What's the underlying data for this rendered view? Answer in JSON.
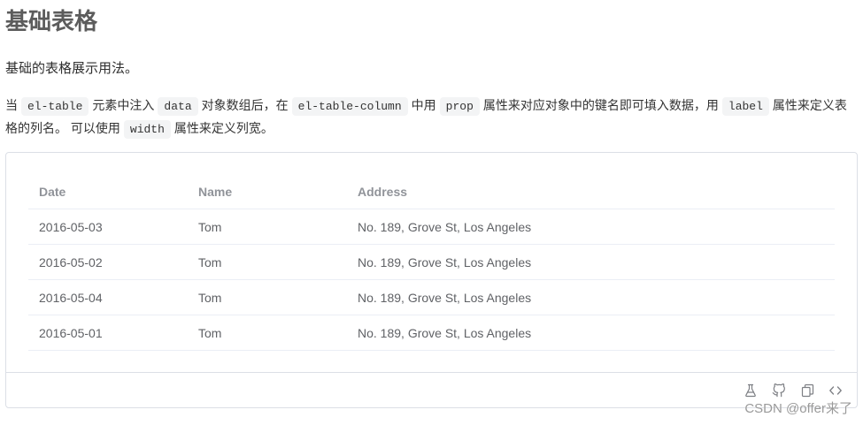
{
  "page": {
    "title": "基础表格",
    "intro": "基础的表格展示用法。",
    "description": [
      {
        "text": "当"
      },
      {
        "code": "el-table"
      },
      {
        "text": "元素中注入"
      },
      {
        "code": "data"
      },
      {
        "text": "对象数组后，在"
      },
      {
        "code": "el-table-column"
      },
      {
        "text": "中用"
      },
      {
        "code": "prop"
      },
      {
        "text": "属性来对应对象中的键名即可填入数据，用"
      },
      {
        "code": "label"
      },
      {
        "text": "属性来定义表格的列名。 可以使用"
      },
      {
        "code": "width"
      },
      {
        "text": "属性来定义列宽。"
      }
    ]
  },
  "table": {
    "columns": [
      "Date",
      "Name",
      "Address"
    ],
    "rows": [
      [
        "2016-05-03",
        "Tom",
        "No. 189, Grove St, Los Angeles"
      ],
      [
        "2016-05-02",
        "Tom",
        "No. 189, Grove St, Los Angeles"
      ],
      [
        "2016-05-04",
        "Tom",
        "No. 189, Grove St, Los Angeles"
      ],
      [
        "2016-05-01",
        "Tom",
        "No. 189, Grove St, Los Angeles"
      ]
    ]
  },
  "demo_toolbar": {
    "icons": [
      "flask-icon",
      "github-icon",
      "copy-icon",
      "code-icon"
    ]
  },
  "watermark": "CSDN @offer来了",
  "colors": {
    "heading": "#5c5c5c",
    "text": "#2f2f2f",
    "header_text": "#909399",
    "cell_text": "#606266",
    "border": "#dcdfe6",
    "row_border": "#ebeef5",
    "code_bg": "#f3f4f5",
    "icon": "#7d7f84"
  }
}
